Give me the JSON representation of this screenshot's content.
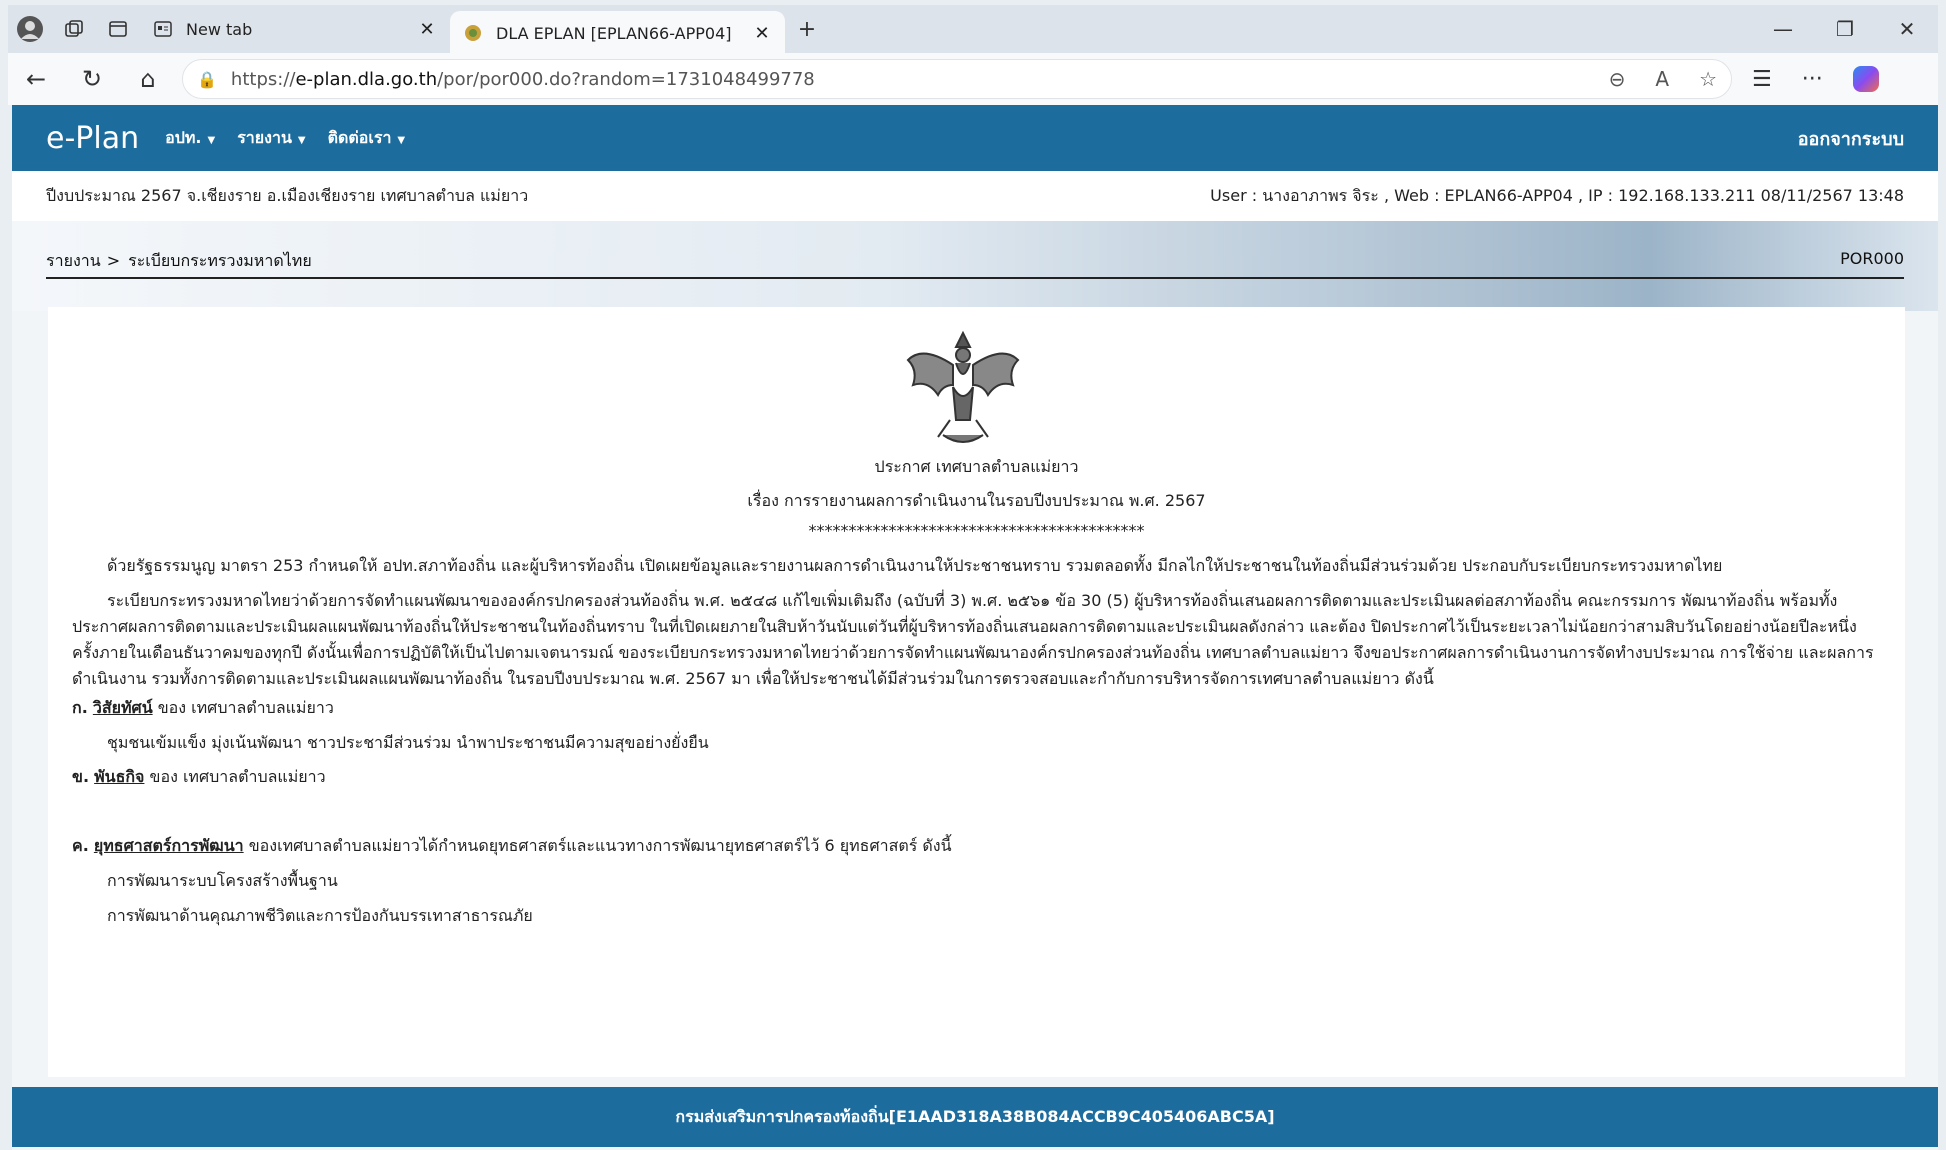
{
  "browser": {
    "tabs": [
      {
        "label": "New tab",
        "active": false
      },
      {
        "label": "DLA EPLAN [EPLAN66-APP04]",
        "active": true
      }
    ],
    "url_prefix": "https://",
    "url_host": "e-plan.dla.go.th",
    "url_path": "/por/por000.do?random=1731048499778"
  },
  "nav": {
    "brand": "e-Plan",
    "menu": [
      "อปท.",
      "รายงาน",
      "ติดต่อเรา"
    ],
    "logout": "ออกจากระบบ"
  },
  "info": {
    "left": "ปีงบประมาณ 2567   จ.เชียงราย อ.เมืองเชียงราย เทศบาลตำบล แม่ยาว",
    "right": "User : นางอาภาพร จิระ , Web : EPLAN66-APP04 , IP : 192.168.133.211 08/11/2567 13:48"
  },
  "breadcrumb": {
    "root": "รายงาน",
    "separator": ">",
    "current": "ระเบียบกระทรวงมหาดไทย",
    "code": "POR000"
  },
  "doc": {
    "announce": "ประกาศ เทศบาลตำบลแม่ยาว",
    "subject": "เรื่อง การรายงานผลการดำเนินงานในรอบปีงบประมาณ พ.ศ. 2567",
    "stars": "******************************************",
    "para1": "ด้วยรัฐธรรมนูญ มาตรา 253 กำหนดให้ อปท.สภาท้องถิ่น และผู้บริหารท้องถิ่น เปิดเผยข้อมูลและรายงานผลการดำเนินงานให้ประชาชนทราบ รวมตลอดทั้ง มีกลไกให้ประชาชนในท้องถิ่นมีส่วนร่วมด้วย ประกอบกับระเบียบกระทรวงมหาดไทย",
    "para2": "ระเบียบกระทรวงมหาดไทยว่าด้วยการจัดทำแผนพัฒนาขององค์กรปกครองส่วนท้องถิ่น พ.ศ. ๒๕๔๘ แก้ไขเพิ่มเติมถึง (ฉบับที่ 3) พ.ศ. ๒๕๖๑ ข้อ 30 (5) ผู้บริหารท้องถิ่นเสนอผลการติดตามและประเมินผลต่อสภาท้องถิ่น คณะกรรมการ พัฒนาท้องถิ่น พร้อมทั้งประกาศผลการติดตามและประเมินผลแผนพัฒนาท้องถิ่นให้ประชาชนในท้องถิ่นทราบ ในที่เปิดเผยภายในสิบห้าวันนับแต่วันที่ผู้บริหารท้องถิ่นเสนอผลการติดตามและประเมินผลดังกล่าว และต้อง ปิดประกาศไว้เป็นระยะเวลาไม่น้อยกว่าสามสิบวันโดยอย่างน้อยปีละหนึ่งครั้งภายในเดือนธันวาคมของทุกปี       ดังนั้นเพื่อการปฏิบัติให้เป็นไปตามเจตนารมณ์ ของระเบียบกระทรวงมหาดไทยว่าด้วยการจัดทำแผนพัฒนาองค์กรปกครองส่วนท้องถิ่น เทศบาลตำบลแม่ยาว จึงขอประกาศผลการดำเนินงานการจัดทำงบประมาณ การใช้จ่าย และผลการดำเนินงาน รวมทั้งการติดตามและประเมินผลแผนพัฒนาท้องถิ่น ในรอบปีงบประมาณ พ.ศ. 2567 มา เพื่อให้ประชาชนได้มีส่วนร่วมในการตรวจสอบและกำกับการบริหารจัดการเทศบาลตำบลแม่ยาว ดังนี้",
    "sec_a_prefix": "ก.",
    "sec_a_title": "วิสัยทัศน์",
    "sec_a_suffix": "ของ เทศบาลตำบลแม่ยาว",
    "vision": "ชุมชนเข้มแข็ง มุ่งเน้นพัฒนา ชาวประชามีส่วนร่วม นำพาประชาชนมีความสุขอย่างยั่งยืน",
    "sec_b_prefix": "ข.",
    "sec_b_title": "พันธกิจ",
    "sec_b_suffix": "ของ เทศบาลตำบลแม่ยาว",
    "sec_c_prefix": "ค.",
    "sec_c_title": "ยุทธศาสตร์การพัฒนา",
    "sec_c_suffix": "ของเทศบาลตำบลแม่ยาวได้กำหนดยุทธศาสตร์และแนวทางการพัฒนายุทธศาสตร์ไว้ 6 ยุทธศาสตร์ ดังนี้",
    "strategies": [
      "การพัฒนาระบบโครงสร้างพื้นฐาน",
      "การพัฒนาด้านคุณภาพชีวิตและการป้องกันบรรเทาสาธารณภัย"
    ]
  },
  "footer": "กรมส่งเสริมการปกครองท้องถิ่น[E1AAD318A38B084ACCB9C405406ABC5A]"
}
